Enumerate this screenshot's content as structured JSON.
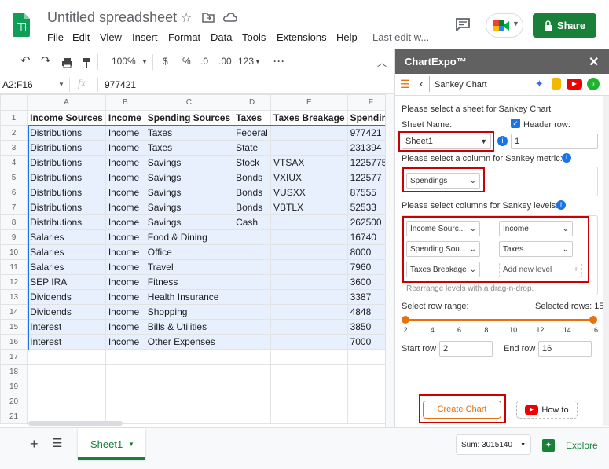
{
  "app": {
    "doc_title": "Untitled spreadsheet",
    "menu": [
      "File",
      "Edit",
      "View",
      "Insert",
      "Format",
      "Data",
      "Tools",
      "Extensions",
      "Help"
    ],
    "last_edit": "Last edit w...",
    "share_label": "Share"
  },
  "toolbar": {
    "zoom": "100%",
    "currency": "$",
    "percent": "%",
    "dec_dec": ".0",
    "dec_inc": ".00",
    "format_123": "123"
  },
  "formula_bar": {
    "name_box": "A2:F16",
    "fx": "fx",
    "value": "977421"
  },
  "grid": {
    "columns": [
      "A",
      "B",
      "C",
      "D",
      "E",
      "F"
    ],
    "rows": [
      [
        "Income Sources",
        "Income",
        "Spending Sources",
        "Taxes",
        "Taxes Breakage",
        "Spendin"
      ],
      [
        "Distributions",
        "Income",
        "Taxes",
        "Federal",
        "",
        "977421"
      ],
      [
        "Distributions",
        "Income",
        "Taxes",
        "State",
        "",
        "231394"
      ],
      [
        "Distributions",
        "Income",
        "Savings",
        "Stock",
        "VTSAX",
        "1225775"
      ],
      [
        "Distributions",
        "Income",
        "Savings",
        "Bonds",
        "VXIUX",
        "122577"
      ],
      [
        "Distributions",
        "Income",
        "Savings",
        "Bonds",
        "VUSXX",
        "87555"
      ],
      [
        "Distributions",
        "Income",
        "Savings",
        "Bonds",
        "VBTLX",
        "52533"
      ],
      [
        "Distributions",
        "Income",
        "Savings",
        "Cash",
        "",
        "262500"
      ],
      [
        "Salaries",
        "Income",
        "Food & Dining",
        "",
        "",
        "16740"
      ],
      [
        "Salaries",
        "Income",
        "Office",
        "",
        "",
        "8000"
      ],
      [
        "Salaries",
        "Income",
        "Travel",
        "",
        "",
        "7960"
      ],
      [
        "SEP IRA",
        "Income",
        "Fitness",
        "",
        "",
        "3600"
      ],
      [
        "Dividends",
        "Income",
        "Health Insurance",
        "",
        "",
        "3387"
      ],
      [
        "Dividends",
        "Income",
        "Shopping",
        "",
        "",
        "4848"
      ],
      [
        "Interest",
        "Income",
        "Bills & Utilities",
        "",
        "",
        "3850"
      ],
      [
        "Interest",
        "Income",
        "Other Expenses",
        "",
        "",
        "7000"
      ],
      [
        "",
        "",
        "",
        "",
        "",
        ""
      ],
      [
        "",
        "",
        "",
        "",
        "",
        ""
      ],
      [
        "",
        "",
        "",
        "",
        "",
        ""
      ],
      [
        "",
        "",
        "",
        "",
        "",
        ""
      ],
      [
        "",
        "",
        "",
        "",
        "",
        ""
      ]
    ]
  },
  "panel": {
    "title": "ChartExpo™",
    "chart_name": "Sankey Chart",
    "select_sheet": "Please select a sheet for Sankey Chart",
    "sheet_name_label": "Sheet Name:",
    "header_row_label": "Header row:",
    "sheet_value": "Sheet1",
    "header_row_value": "1",
    "metric_label": "Please select a column for Sankey metric:",
    "metric_value": "Spendings",
    "levels_label": "Please select columns for Sankey levels:",
    "levels": [
      "Income Sourc...",
      "Income",
      "Spending Sou...",
      "Taxes",
      "Taxes Breakage"
    ],
    "add_level": "Add new level",
    "rearrange_hint": "Rearrange levels with a drag-n-drop.",
    "row_range_label": "Select row range:",
    "selected_rows_label": "Selected rows: 15",
    "ticks": [
      "2",
      "4",
      "6",
      "8",
      "10",
      "12",
      "14",
      "16"
    ],
    "start_row_label": "Start row",
    "start_row_value": "2",
    "end_row_label": "End row",
    "end_row_value": "16",
    "create_chart": "Create Chart",
    "how_to": "How to"
  },
  "bottom": {
    "sheet_tab": "Sheet1",
    "sum": "Sum: 3015140",
    "explore": "Explore"
  },
  "colors": {
    "share_green": "#188038",
    "selection_blue": "#e8f0fe",
    "panel_header": "#616161",
    "accent_red": "#cc0000",
    "slider_orange": "#e8710a"
  }
}
